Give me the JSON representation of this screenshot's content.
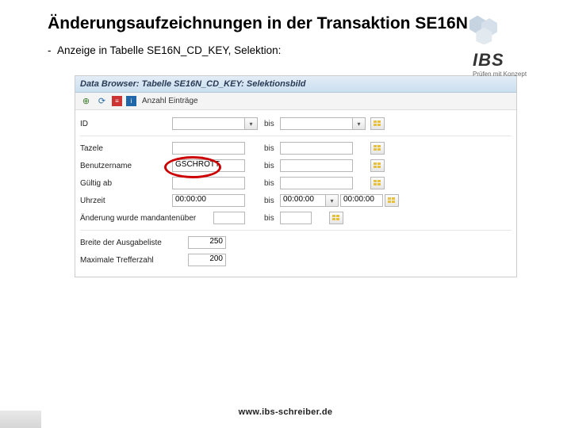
{
  "title": "Änderungsaufzeichnungen in der Transaktion SE16N",
  "logo": {
    "name": "IBS",
    "sub": "Prüfen mit Konzept"
  },
  "bullet": "Anzeige in Tabelle SE16N_CD_KEY, Selektion:",
  "sap": {
    "title": "Data Browser: Tabelle SE16N_CD_KEY: Selektionsbild",
    "toolbar_label": "Anzahl Einträge",
    "fields": {
      "id": {
        "label": "ID",
        "from": "",
        "to": ""
      },
      "tazele": {
        "label": "Tazele",
        "from": "",
        "to": ""
      },
      "benutzer": {
        "label": "Benutzername",
        "from": "GSCHROTT",
        "to": ""
      },
      "gueltig": {
        "label": "Gültig ab",
        "from": "",
        "to": ""
      },
      "uhrzeit": {
        "label": "Uhrzeit",
        "from": "00:00:00",
        "to": "00:00:00"
      },
      "aenderung": {
        "label": "Änderung wurde mandantenüber",
        "from": "",
        "to": ""
      },
      "breite": {
        "label": "Breite der Ausgabeliste",
        "value": "250"
      },
      "max": {
        "label": "Maximale Trefferzahl",
        "value": "200"
      }
    },
    "bis": "bis"
  },
  "footer": "www.ibs-schreiber.de"
}
